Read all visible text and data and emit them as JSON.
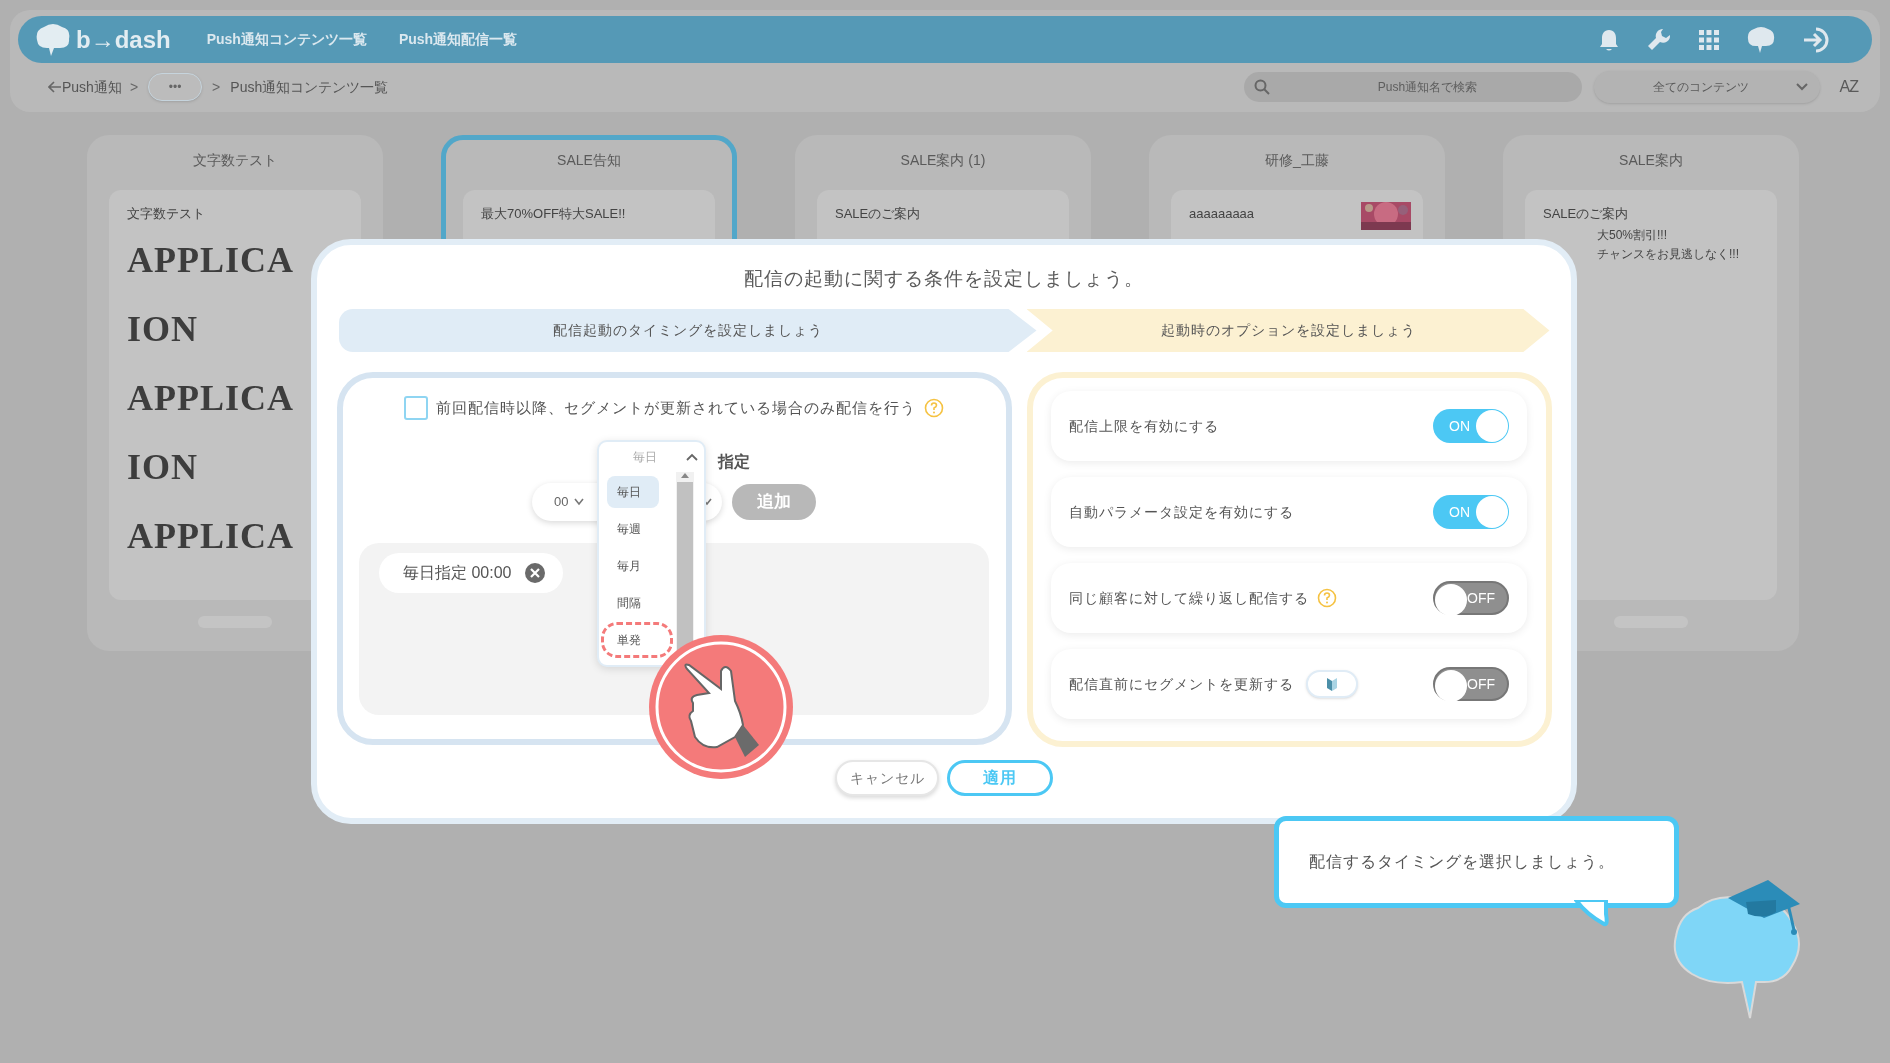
{
  "header": {
    "logo": "b→dash",
    "nav": [
      {
        "label": "Push通知コンテンツ一覧"
      },
      {
        "label": "Push通知配信一覧"
      }
    ]
  },
  "breadcrumb": [
    {
      "kind": "link",
      "text": "Push通知"
    },
    {
      "kind": "sep",
      "text": ">"
    },
    {
      "kind": "more",
      "text": "•••"
    },
    {
      "kind": "sep",
      "text": ">"
    },
    {
      "kind": "current",
      "text": "Push通知コンテンツ一覧"
    }
  ],
  "search": {
    "placeholder": "Push通知名で検索"
  },
  "filter": {
    "value": "全てのコンテンツ"
  },
  "sort_button": "AZ",
  "cards": [
    {
      "title": "文字数テスト",
      "selected": false,
      "scroll_handle": true,
      "body": [
        {
          "kind": "text",
          "text": "文字数テスト"
        },
        {
          "kind": "display",
          "text": "APPLICA"
        },
        {
          "kind": "display",
          "text": "ION"
        },
        {
          "kind": "display",
          "text": "APPLICA"
        },
        {
          "kind": "display",
          "text": "ION"
        },
        {
          "kind": "display",
          "text": "APPLICA"
        }
      ]
    },
    {
      "title": "SALE告知",
      "selected": true,
      "scroll_handle": false,
      "body": [
        {
          "kind": "text",
          "text": "最大70%OFF特大SALE!!"
        }
      ]
    },
    {
      "title": "SALE案内 (1)",
      "selected": false,
      "scroll_handle": false,
      "body": [
        {
          "kind": "text",
          "text": "SALEのご案内"
        }
      ]
    },
    {
      "title": "研修_工藤",
      "selected": false,
      "scroll_handle": false,
      "thumbnail": true,
      "body": [
        {
          "kind": "text",
          "text": "aaaaaaaaa"
        }
      ]
    },
    {
      "title": "SALE案内",
      "selected": false,
      "scroll_handle": true,
      "body": [
        {
          "kind": "text",
          "text": "SALEのご案内"
        },
        {
          "kind": "partial",
          "text": "大50%割引!!!"
        },
        {
          "kind": "partial",
          "text": "チャンスをお見逃しなく!!!"
        }
      ]
    }
  ],
  "modal": {
    "title": "配信の起動に関する条件を設定しましょう。",
    "steps": [
      {
        "label": "配信起動のタイミングを設定しましょう",
        "kind": "timing"
      },
      {
        "label": "起動時のオプションを設定しましょう",
        "kind": "options"
      }
    ],
    "segment_check": {
      "label": "前回配信時以降、セグメントが更新されている場合のみ配信を行う",
      "checked": false,
      "help": true
    },
    "dropdown": {
      "value": "毎日",
      "expanded": true,
      "options": [
        {
          "label": "毎日",
          "selected": true,
          "highlighted": false
        },
        {
          "label": "毎週",
          "selected": false,
          "highlighted": false
        },
        {
          "label": "毎月",
          "selected": false,
          "highlighted": false
        },
        {
          "label": "間隔",
          "selected": false,
          "highlighted": false
        },
        {
          "label": "単発",
          "selected": false,
          "highlighted": true
        }
      ]
    },
    "specify_label": "指定",
    "time_select": {
      "value": "00"
    },
    "add_button": {
      "label": "追加",
      "disabled": true
    },
    "schedules": [
      {
        "label": "毎日指定 00:00"
      }
    ],
    "options": [
      {
        "label": "配信上限を有効にする",
        "on": true,
        "toggle_text": "ON",
        "help": false,
        "badge": false
      },
      {
        "label": "自動パラメータ設定を有効にする",
        "on": true,
        "toggle_text": "ON",
        "help": false,
        "badge": false
      },
      {
        "label": "同じ顧客に対して繰り返し配信する",
        "on": false,
        "toggle_text": "OFF",
        "help": true,
        "badge": false
      },
      {
        "label": "配信直前にセグメントを更新する",
        "on": false,
        "toggle_text": "OFF",
        "help": false,
        "badge": true
      }
    ],
    "buttons": [
      {
        "label": "キャンセル",
        "kind": "cancel"
      },
      {
        "label": "適用",
        "kind": "apply"
      }
    ]
  },
  "tooltip": {
    "text": "配信するタイミングを選択しましょう。"
  }
}
